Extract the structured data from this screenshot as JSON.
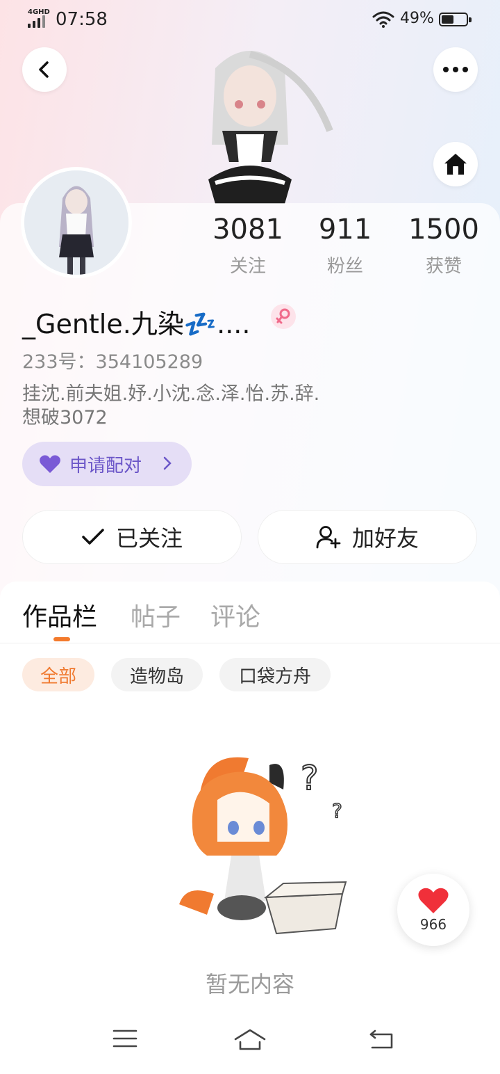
{
  "status_bar": {
    "network": "4GHD",
    "time": "07:58",
    "battery": "49%",
    "battery_level": 0.49,
    "icons": [
      "signal-icon",
      "wifi-icon",
      "battery-icon"
    ]
  },
  "header": {
    "back_icon": "chevron-left-icon",
    "more_icon": "more-dots-icon",
    "home_icon": "home-icon"
  },
  "profile": {
    "username": "_Gentle.九染💤....",
    "gender_icon": "female-icon",
    "id_line": "233号：354105289",
    "bio_line1": "挂沈.前夫姐.妤.小沈.念.泽.怡.苏.辞.",
    "bio_line2": "想破3072"
  },
  "stats": [
    {
      "value": "3081",
      "label": "关注"
    },
    {
      "value": "911",
      "label": "粉丝"
    },
    {
      "value": "1500",
      "label": "获赞"
    }
  ],
  "pair_button": {
    "label": "申请配对",
    "icon": "purple-heart-icon"
  },
  "actions": {
    "followed_label": "已关注",
    "add_friend_label": "加好友"
  },
  "tabs": [
    {
      "label": "作品栏",
      "active": true
    },
    {
      "label": "帖子",
      "active": false
    },
    {
      "label": "评论",
      "active": false
    }
  ],
  "chips": [
    {
      "label": "全部",
      "active": true
    },
    {
      "label": "造物岛",
      "active": false
    },
    {
      "label": "口袋方舟",
      "active": false
    }
  ],
  "empty_state": {
    "text": "暂无内容"
  },
  "like_fab": {
    "count": "966",
    "icon": "heart-icon"
  },
  "nav_bar": {
    "icons": [
      "menu-icon",
      "home-icon",
      "back-icon"
    ]
  },
  "colors": {
    "accent_orange": "#f37a2c",
    "pair_purple": "#6b56c8",
    "heart_red": "#f0303a"
  }
}
